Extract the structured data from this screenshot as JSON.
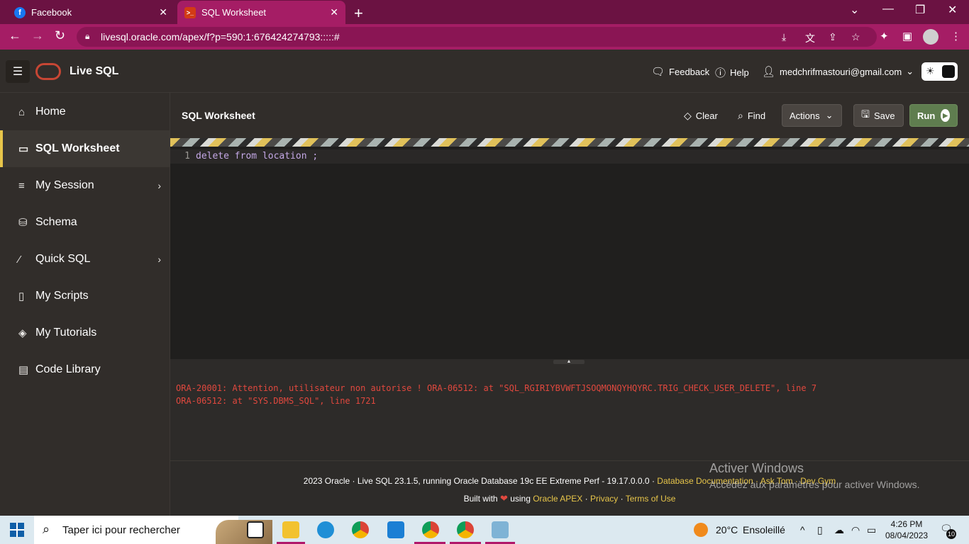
{
  "browser": {
    "tabs": [
      {
        "title": "Facebook",
        "icon": "facebook-icon"
      },
      {
        "title": "SQL Worksheet",
        "icon": "oracle-sql-icon"
      }
    ],
    "url": "livesql.oracle.com/apex/f?p=590:1:676424274793:::::#"
  },
  "header": {
    "app_title": "Live SQL",
    "feedback": "Feedback",
    "help": "Help",
    "user_email": "medchrifmastouri@gmail.com"
  },
  "sidebar": {
    "items": [
      {
        "label": "Home",
        "icon": "home-icon"
      },
      {
        "label": "SQL Worksheet",
        "icon": "worksheet-icon",
        "active": true
      },
      {
        "label": "My Session",
        "icon": "menu-icon",
        "has_children": true
      },
      {
        "label": "Schema",
        "icon": "database-icon"
      },
      {
        "label": "Quick SQL",
        "icon": "wand-icon",
        "has_children": true
      },
      {
        "label": "My Scripts",
        "icon": "file-icon"
      },
      {
        "label": "My Tutorials",
        "icon": "graduation-icon"
      },
      {
        "label": "Code Library",
        "icon": "briefcase-icon"
      }
    ]
  },
  "worksheet": {
    "title": "SQL Worksheet",
    "clear": "Clear",
    "find": "Find",
    "actions": "Actions",
    "save": "Save",
    "run": "Run"
  },
  "editor": {
    "line_number": "1",
    "code": "delete from location ;"
  },
  "output": {
    "line1": "ORA-20001: Attention, utilisateur non autorise ! ORA-06512: at \"SQL_RGIRIYBVWFTJSOQMONQYHQYRC.TRIG_CHECK_USER_DELETE\", line 7",
    "line2": "ORA-06512: at \"SYS.DBMS_SQL\", line 1721"
  },
  "footer": {
    "copyright": "2023 Oracle · Live SQL 23.1.5, running Oracle Database 19c EE Extreme Perf - 19.17.0.0.0 ·",
    "link_docs": "Database Documentation",
    "link_asktom": "Ask Tom",
    "link_devgym": "Dev Gym",
    "built_with": "Built with",
    "using": "using",
    "link_apex": "Oracle APEX",
    "link_privacy": "Privacy",
    "link_terms": "Terms of Use",
    "sep": "·"
  },
  "watermark": {
    "title": "Activer Windows",
    "subtitle": "Accédez aux paramètres pour activer Windows."
  },
  "taskbar": {
    "search_placeholder": "Taper ici pour rechercher",
    "weather_temp": "20°C",
    "weather_desc": "Ensoleillé",
    "time": "4:26 PM",
    "date": "08/04/2023",
    "notifications": "10"
  },
  "colors": {
    "accent_yellow": "#e7c54a",
    "run_green": "#5f7d4f",
    "error_red": "#e0483e",
    "browser_pink": "#a51d65"
  }
}
